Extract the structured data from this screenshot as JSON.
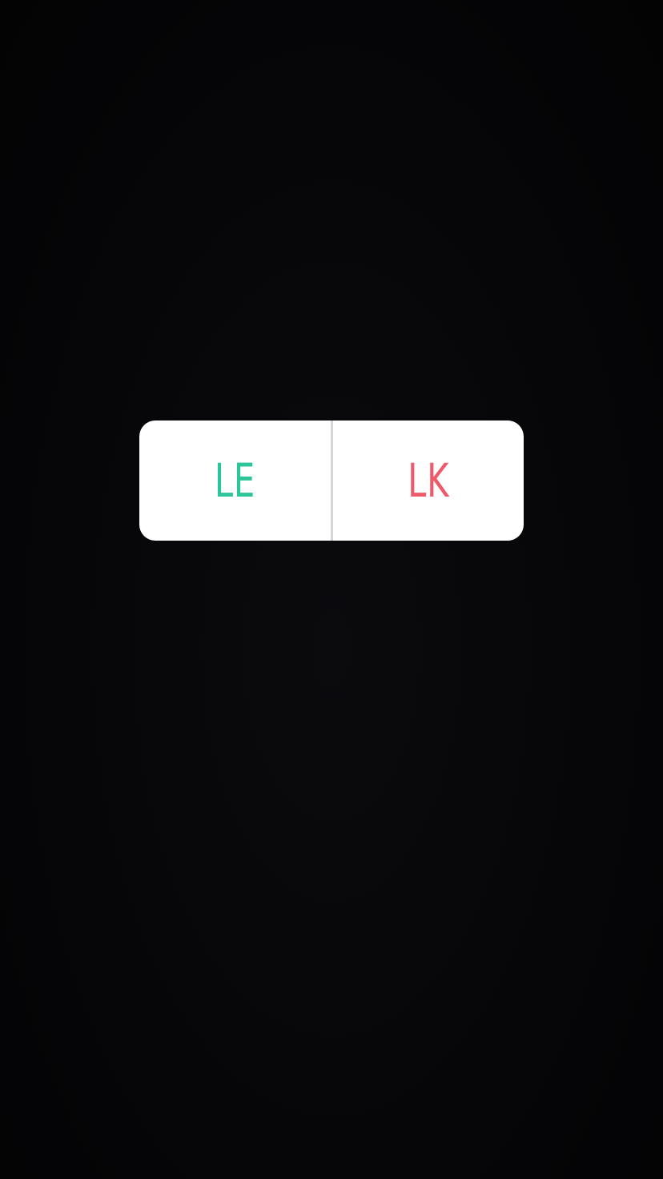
{
  "poll": {
    "option_left": {
      "label": "LE",
      "color": "#2cc59a"
    },
    "option_right": {
      "label": "LK",
      "color": "#ef5a6b"
    }
  },
  "colors": {
    "background": "#060608",
    "sticker_background": "#ffffff",
    "divider": "#d6d6d6"
  }
}
